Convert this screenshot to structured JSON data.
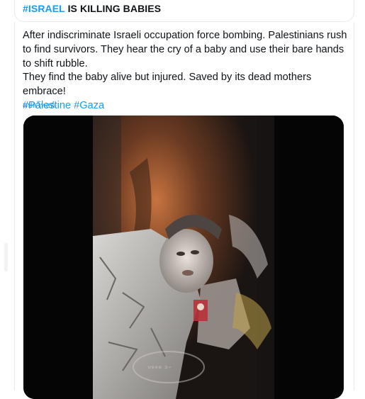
{
  "header": {
    "hashtag": "#ISRAEL",
    "headline_rest": " IS KILLING BABIES"
  },
  "tweet": {
    "line1": "After indiscriminate Israeli occupation force bombing. Palestinians rush to find survivors. They hear the cry of a baby and use their bare hands to shift rubble.",
    "line2": "They find the baby alive but injured. Saved by its dead mothers embrace!",
    "hashtags": [
      "#Palestine",
      "#Gaza"
    ],
    "translate_label": "แปลโพสต์"
  },
  "media": {
    "watermark": "ᐡᐤᐤᐤ ᐣᐨ"
  },
  "colors": {
    "link": "#1d9bf0",
    "text": "#0f1419",
    "border": "#e7e9ec"
  }
}
